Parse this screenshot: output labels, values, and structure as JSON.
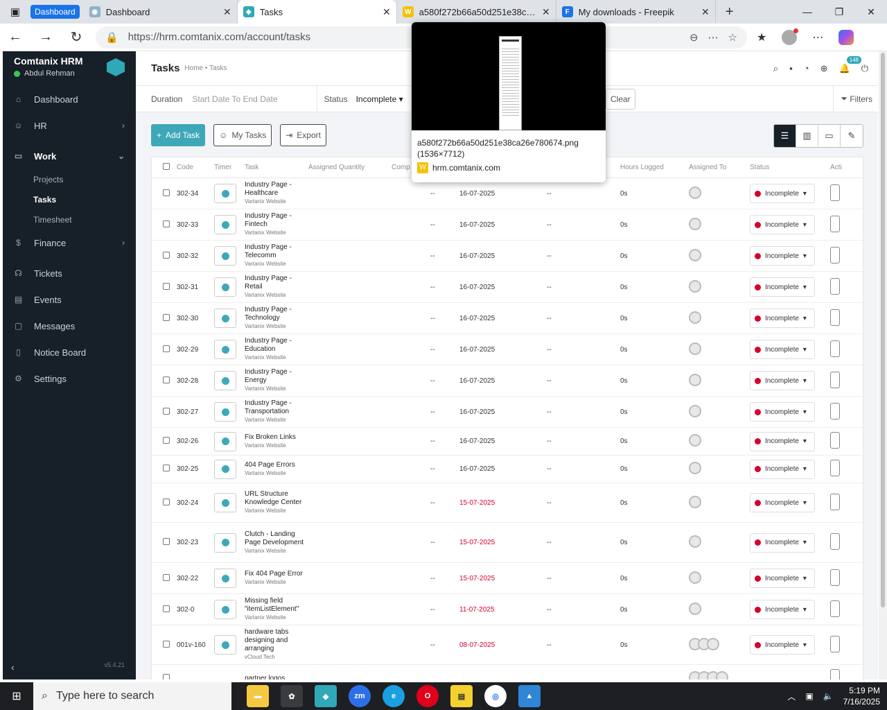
{
  "browser": {
    "tab_group": "Dashboard",
    "tabs": [
      {
        "title": "Dashboard",
        "active": false
      },
      {
        "title": "Tasks",
        "active": true
      },
      {
        "title": "a580f272b66a50d251e38ca26e780674",
        "active": false
      },
      {
        "title": "My downloads - Freepik",
        "active": false
      }
    ],
    "url": "https://hrm.comtanix.com/account/tasks"
  },
  "preview": {
    "filename": "a580f272b66a50d251e38ca26e780674.png",
    "dims": "(1536×7712)",
    "site": "hrm.comtanix.com"
  },
  "sidebar": {
    "app_name": "Comtanix HRM",
    "user_name": "Abdul Rehman",
    "items": {
      "dashboard": "Dashboard",
      "hr": "HR",
      "work": "Work",
      "projects": "Projects",
      "tasks": "Tasks",
      "timesheet": "Timesheet",
      "finance": "Finance",
      "tickets": "Tickets",
      "events": "Events",
      "messages": "Messages",
      "notice_board": "Notice Board",
      "settings": "Settings"
    },
    "version": "v5.4.21"
  },
  "header": {
    "title": "Tasks",
    "breadcrumb": "Home • Tasks",
    "notification_count": "148"
  },
  "filters": {
    "duration_label": "Duration",
    "duration_placeholder": "Start Date To End Date",
    "status_label": "Status",
    "status_value": "Incomplete",
    "clear": "Clear",
    "filters": "Filters"
  },
  "actions": {
    "add_task": "Add Task",
    "my_tasks": "My Tasks",
    "export": "Export"
  },
  "table": {
    "columns": {
      "code": "Code",
      "timer": "Timer",
      "task": "Task",
      "assigned_quantity": "Assigned Quantity",
      "completed": "Comp",
      "due_date": "ue Date",
      "hours_logged": "Hours Logged",
      "assigned_to": "Assigned To",
      "status": "Status",
      "action": "Acti"
    },
    "rows": [
      {
        "code": "302-34",
        "task": "Industry Page - Healthcare",
        "project": "Vartanix Website",
        "completed": "--",
        "due": "16-07-2025",
        "due_overdue": false,
        "dash2": "--",
        "hours": "0s",
        "status": "Incomplete",
        "avatars": 1
      },
      {
        "code": "302-33",
        "task": "Industry Page - Fintech",
        "project": "Vartanix Website",
        "completed": "--",
        "due": "16-07-2025",
        "due_overdue": false,
        "dash2": "--",
        "hours": "0s",
        "status": "Incomplete",
        "avatars": 1
      },
      {
        "code": "302-32",
        "task": "Industry Page - Telecomm",
        "project": "Vartanix Website",
        "completed": "--",
        "due": "16-07-2025",
        "due_overdue": false,
        "dash2": "--",
        "hours": "0s",
        "status": "Incomplete",
        "avatars": 1
      },
      {
        "code": "302-31",
        "task": "Industry Page - Retail",
        "project": "Vartanix Website",
        "completed": "--",
        "due": "16-07-2025",
        "due_overdue": false,
        "dash2": "--",
        "hours": "0s",
        "status": "Incomplete",
        "avatars": 1
      },
      {
        "code": "302-30",
        "task": "Industry Page - Technology",
        "project": "Vartanix Website",
        "completed": "--",
        "due": "16-07-2025",
        "due_overdue": false,
        "dash2": "--",
        "hours": "0s",
        "status": "Incomplete",
        "avatars": 1
      },
      {
        "code": "302-29",
        "task": "Industry Page - Education",
        "project": "Vartanix Website",
        "completed": "--",
        "due": "16-07-2025",
        "due_overdue": false,
        "dash2": "--",
        "hours": "0s",
        "status": "Incomplete",
        "avatars": 1
      },
      {
        "code": "302-28",
        "task": "Industry Page - Energy",
        "project": "Vartanix Website",
        "completed": "--",
        "due": "16-07-2025",
        "due_overdue": false,
        "dash2": "--",
        "hours": "0s",
        "status": "Incomplete",
        "avatars": 1
      },
      {
        "code": "302-27",
        "task": "Industry Page - Transportation",
        "project": "Vartanix Website",
        "completed": "--",
        "due": "16-07-2025",
        "due_overdue": false,
        "dash2": "--",
        "hours": "0s",
        "status": "Incomplete",
        "avatars": 1
      },
      {
        "code": "302-26",
        "task": "Fix Broken Links",
        "project": "Vartanix Website",
        "completed": "--",
        "due": "16-07-2025",
        "due_overdue": false,
        "dash2": "--",
        "hours": "0s",
        "status": "Incomplete",
        "avatars": 1
      },
      {
        "code": "302-25",
        "task": "404 Page Errors",
        "project": "Vartanix Website",
        "completed": "--",
        "due": "16-07-2025",
        "due_overdue": false,
        "dash2": "--",
        "hours": "0s",
        "status": "Incomplete",
        "avatars": 1
      },
      {
        "code": "302-24",
        "task": "URL Structure Knowledge Center",
        "project": "Vartanix Website",
        "completed": "--",
        "due": "15-07-2025",
        "due_overdue": true,
        "dash2": "--",
        "hours": "0s",
        "status": "Incomplete",
        "avatars": 1
      },
      {
        "code": "302-23",
        "task": "Clutch - Landing Page Development",
        "project": "Vartanix Website",
        "completed": "--",
        "due": "15-07-2025",
        "due_overdue": true,
        "dash2": "--",
        "hours": "0s",
        "status": "Incomplete",
        "avatars": 1
      },
      {
        "code": "302-22",
        "task": "Fix 404 Page Error",
        "project": "Vartanix Website",
        "completed": "--",
        "due": "15-07-2025",
        "due_overdue": true,
        "dash2": "--",
        "hours": "0s",
        "status": "Incomplete",
        "avatars": 1
      },
      {
        "code": "302-0",
        "task": "Missing field \"itemListElement\"",
        "project": "Vartanix Website",
        "completed": "--",
        "due": "11-07-2025",
        "due_overdue": true,
        "dash2": "--",
        "hours": "0s",
        "status": "Incomplete",
        "avatars": 1
      },
      {
        "code": "001v-160",
        "task": "hardware tabs designing and arranging",
        "project": "vCloud Tech",
        "completed": "--",
        "due": "08-07-2025",
        "due_overdue": true,
        "dash2": "--",
        "hours": "0s",
        "status": "Incomplete",
        "avatars": 3
      },
      {
        "code": "",
        "task": "partner logos",
        "project": "",
        "completed": "",
        "due": "",
        "due_overdue": false,
        "dash2": "",
        "hours": "",
        "status": "",
        "avatars": 4
      }
    ]
  },
  "taskbar": {
    "search_placeholder": "Type here to search",
    "time": "5:19 PM",
    "date": "7/16/2025"
  },
  "colors": {
    "accent": "#3fa8b8",
    "sidebar_bg": "#171f29",
    "overdue": "#d6002b"
  }
}
